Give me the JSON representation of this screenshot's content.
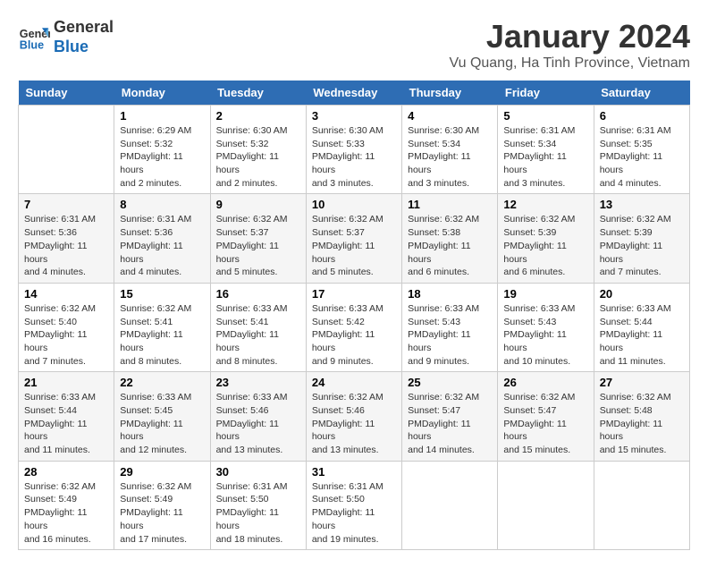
{
  "header": {
    "logo_line1": "General",
    "logo_line2": "Blue",
    "title": "January 2024",
    "subtitle": "Vu Quang, Ha Tinh Province, Vietnam"
  },
  "days_of_week": [
    "Sunday",
    "Monday",
    "Tuesday",
    "Wednesday",
    "Thursday",
    "Friday",
    "Saturday"
  ],
  "weeks": [
    [
      {
        "day": "",
        "info": ""
      },
      {
        "day": "1",
        "info": "Sunrise: 6:29 AM\nSunset: 5:32 PM\nDaylight: 11 hours\nand 2 minutes."
      },
      {
        "day": "2",
        "info": "Sunrise: 6:30 AM\nSunset: 5:32 PM\nDaylight: 11 hours\nand 2 minutes."
      },
      {
        "day": "3",
        "info": "Sunrise: 6:30 AM\nSunset: 5:33 PM\nDaylight: 11 hours\nand 3 minutes."
      },
      {
        "day": "4",
        "info": "Sunrise: 6:30 AM\nSunset: 5:34 PM\nDaylight: 11 hours\nand 3 minutes."
      },
      {
        "day": "5",
        "info": "Sunrise: 6:31 AM\nSunset: 5:34 PM\nDaylight: 11 hours\nand 3 minutes."
      },
      {
        "day": "6",
        "info": "Sunrise: 6:31 AM\nSunset: 5:35 PM\nDaylight: 11 hours\nand 4 minutes."
      }
    ],
    [
      {
        "day": "7",
        "info": "Sunrise: 6:31 AM\nSunset: 5:36 PM\nDaylight: 11 hours\nand 4 minutes."
      },
      {
        "day": "8",
        "info": "Sunrise: 6:31 AM\nSunset: 5:36 PM\nDaylight: 11 hours\nand 4 minutes."
      },
      {
        "day": "9",
        "info": "Sunrise: 6:32 AM\nSunset: 5:37 PM\nDaylight: 11 hours\nand 5 minutes."
      },
      {
        "day": "10",
        "info": "Sunrise: 6:32 AM\nSunset: 5:37 PM\nDaylight: 11 hours\nand 5 minutes."
      },
      {
        "day": "11",
        "info": "Sunrise: 6:32 AM\nSunset: 5:38 PM\nDaylight: 11 hours\nand 6 minutes."
      },
      {
        "day": "12",
        "info": "Sunrise: 6:32 AM\nSunset: 5:39 PM\nDaylight: 11 hours\nand 6 minutes."
      },
      {
        "day": "13",
        "info": "Sunrise: 6:32 AM\nSunset: 5:39 PM\nDaylight: 11 hours\nand 7 minutes."
      }
    ],
    [
      {
        "day": "14",
        "info": "Sunrise: 6:32 AM\nSunset: 5:40 PM\nDaylight: 11 hours\nand 7 minutes."
      },
      {
        "day": "15",
        "info": "Sunrise: 6:32 AM\nSunset: 5:41 PM\nDaylight: 11 hours\nand 8 minutes."
      },
      {
        "day": "16",
        "info": "Sunrise: 6:33 AM\nSunset: 5:41 PM\nDaylight: 11 hours\nand 8 minutes."
      },
      {
        "day": "17",
        "info": "Sunrise: 6:33 AM\nSunset: 5:42 PM\nDaylight: 11 hours\nand 9 minutes."
      },
      {
        "day": "18",
        "info": "Sunrise: 6:33 AM\nSunset: 5:43 PM\nDaylight: 11 hours\nand 9 minutes."
      },
      {
        "day": "19",
        "info": "Sunrise: 6:33 AM\nSunset: 5:43 PM\nDaylight: 11 hours\nand 10 minutes."
      },
      {
        "day": "20",
        "info": "Sunrise: 6:33 AM\nSunset: 5:44 PM\nDaylight: 11 hours\nand 11 minutes."
      }
    ],
    [
      {
        "day": "21",
        "info": "Sunrise: 6:33 AM\nSunset: 5:44 PM\nDaylight: 11 hours\nand 11 minutes."
      },
      {
        "day": "22",
        "info": "Sunrise: 6:33 AM\nSunset: 5:45 PM\nDaylight: 11 hours\nand 12 minutes."
      },
      {
        "day": "23",
        "info": "Sunrise: 6:33 AM\nSunset: 5:46 PM\nDaylight: 11 hours\nand 13 minutes."
      },
      {
        "day": "24",
        "info": "Sunrise: 6:32 AM\nSunset: 5:46 PM\nDaylight: 11 hours\nand 13 minutes."
      },
      {
        "day": "25",
        "info": "Sunrise: 6:32 AM\nSunset: 5:47 PM\nDaylight: 11 hours\nand 14 minutes."
      },
      {
        "day": "26",
        "info": "Sunrise: 6:32 AM\nSunset: 5:47 PM\nDaylight: 11 hours\nand 15 minutes."
      },
      {
        "day": "27",
        "info": "Sunrise: 6:32 AM\nSunset: 5:48 PM\nDaylight: 11 hours\nand 15 minutes."
      }
    ],
    [
      {
        "day": "28",
        "info": "Sunrise: 6:32 AM\nSunset: 5:49 PM\nDaylight: 11 hours\nand 16 minutes."
      },
      {
        "day": "29",
        "info": "Sunrise: 6:32 AM\nSunset: 5:49 PM\nDaylight: 11 hours\nand 17 minutes."
      },
      {
        "day": "30",
        "info": "Sunrise: 6:31 AM\nSunset: 5:50 PM\nDaylight: 11 hours\nand 18 minutes."
      },
      {
        "day": "31",
        "info": "Sunrise: 6:31 AM\nSunset: 5:50 PM\nDaylight: 11 hours\nand 19 minutes."
      },
      {
        "day": "",
        "info": ""
      },
      {
        "day": "",
        "info": ""
      },
      {
        "day": "",
        "info": ""
      }
    ]
  ]
}
